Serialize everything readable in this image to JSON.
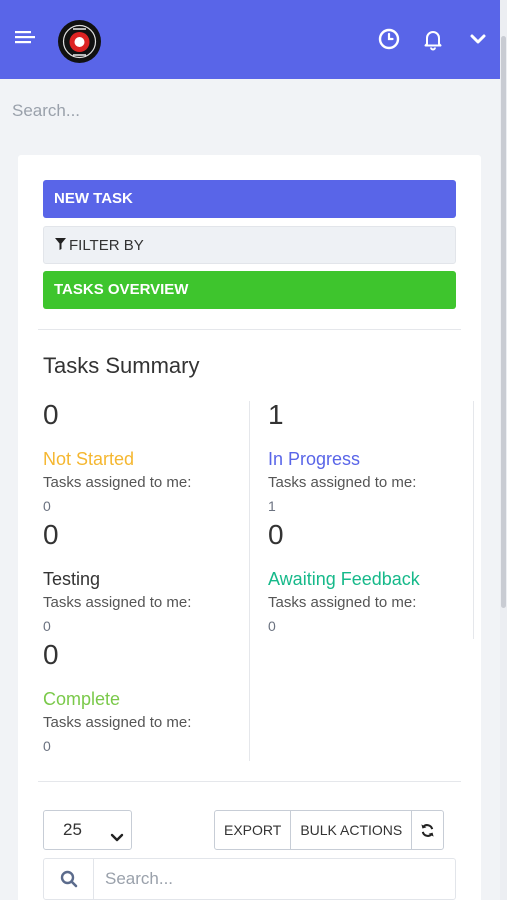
{
  "header": {
    "menu_icon": "hamburger-icon",
    "logo_icon": "business-logo",
    "clock_icon": "clock-icon",
    "bell_icon": "bell-icon",
    "dropdown_icon": "chevron-down-icon",
    "bg_color": "#5965e8"
  },
  "top_search": {
    "placeholder": "Search..."
  },
  "actions": {
    "new_task": "NEW TASK",
    "filter_by": "FILTER BY",
    "filter_icon": "filter-icon",
    "tasks_overview": "TASKS OVERVIEW"
  },
  "summary": {
    "title": "Tasks Summary",
    "sub_label": "Tasks assigned to me:",
    "items": [
      {
        "count": "0",
        "label": "Not Started",
        "assigned": "0",
        "color": "#f5b730"
      },
      {
        "count": "1",
        "label": "In Progress",
        "assigned": "1",
        "color": "#5965e8"
      },
      {
        "count": "0",
        "label": "Testing",
        "assigned": "0",
        "color": "#333333"
      },
      {
        "count": "0",
        "label": "Awaiting Feedback",
        "assigned": "0",
        "color": "#16b98a"
      },
      {
        "count": "0",
        "label": "Complete",
        "assigned": "0",
        "color": "#7ac94a"
      }
    ]
  },
  "table_controls": {
    "page_size": "25",
    "export": "EXPORT",
    "bulk_actions": "BULK ACTIONS",
    "refresh_icon": "refresh-icon",
    "search_icon": "search-icon",
    "search_placeholder": "Search..."
  }
}
